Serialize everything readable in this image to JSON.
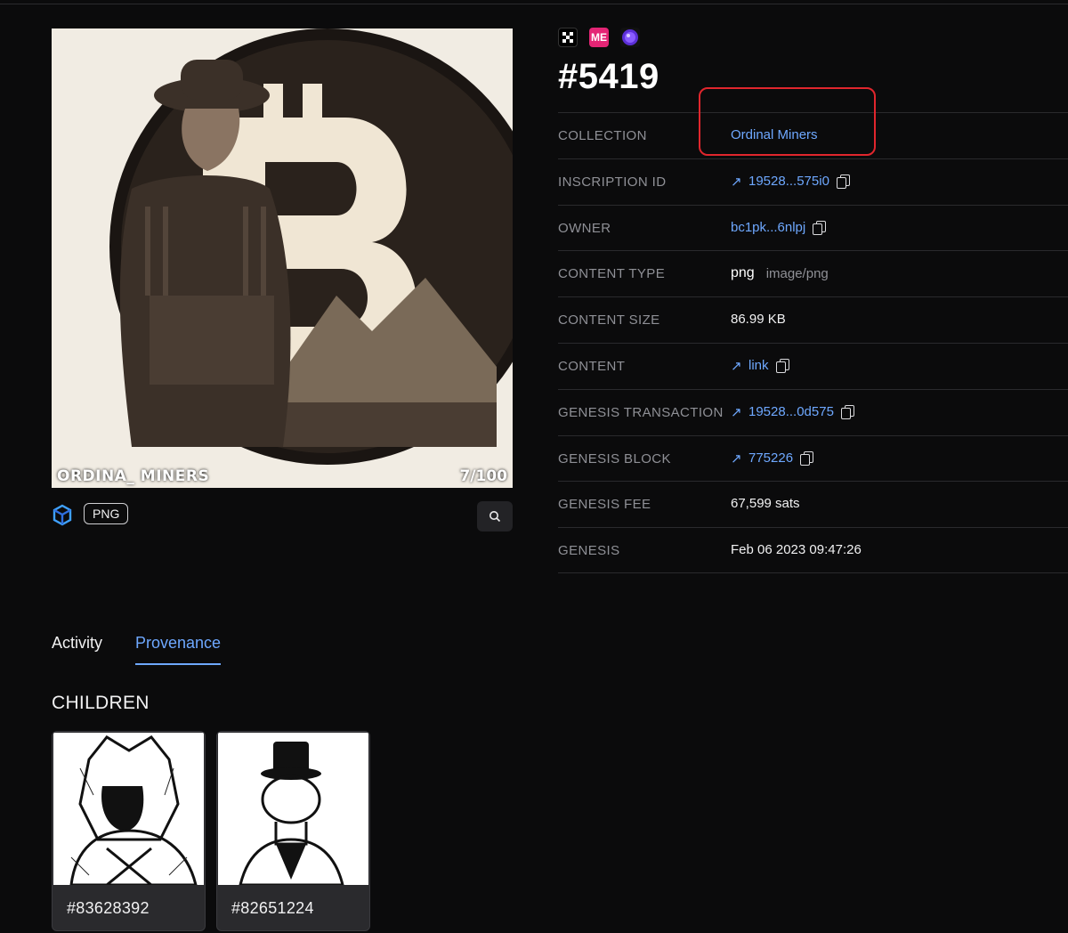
{
  "hero": {
    "caption_left": "ORDINA_ MINERS",
    "caption_right": "7/100",
    "format_badge": "PNG"
  },
  "marketplaces": {
    "okx_icon": "okx-icon",
    "magic_eden_label": "ME",
    "orb_icon": "orb-icon"
  },
  "inscription": {
    "title": "#5419"
  },
  "details": [
    {
      "label": "COLLECTION",
      "value": "Ordinal Miners"
    },
    {
      "label": "INSCRIPTION ID",
      "value": "19528...575i0"
    },
    {
      "label": "OWNER",
      "value": "bc1pk...6nlpj"
    },
    {
      "label": "CONTENT TYPE",
      "value": "png",
      "sub": "image/png"
    },
    {
      "label": "CONTENT SIZE",
      "value": "86.99 KB"
    },
    {
      "label": "CONTENT",
      "value": "link"
    },
    {
      "label": "GENESIS TRANSACTION",
      "value": "19528...0d575"
    },
    {
      "label": "GENESIS BLOCK",
      "value": "775226"
    },
    {
      "label": "GENESIS FEE",
      "value": "67,599 sats"
    },
    {
      "label": "GENESIS",
      "value": "Feb 06 2023 09:47:26"
    }
  ],
  "tabs": [
    {
      "label": "Activity"
    },
    {
      "label": "Provenance"
    }
  ],
  "children": {
    "title": "CHILDREN",
    "items": [
      {
        "label": "#83628392"
      },
      {
        "label": "#82651224"
      }
    ]
  },
  "colors": {
    "background": "#0b0b0c",
    "link": "#6ea8ff",
    "highlight": "#e0262d"
  }
}
